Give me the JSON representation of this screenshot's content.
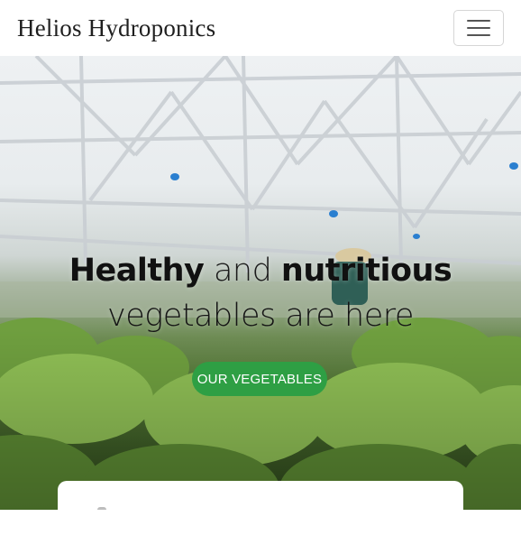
{
  "navbar": {
    "brand": "Helios Hydroponics"
  },
  "hero": {
    "headline": {
      "bold_1": "Healthy",
      "light_1": " and ",
      "bold_2": "nutritious",
      "line2": "vegetables are here"
    },
    "cta_label": "OUR VEGETABLES"
  },
  "colors": {
    "accent": "#2e9f44",
    "brand_text": "#1f1f1f"
  },
  "icons": {
    "menu": "hamburger-icon"
  }
}
